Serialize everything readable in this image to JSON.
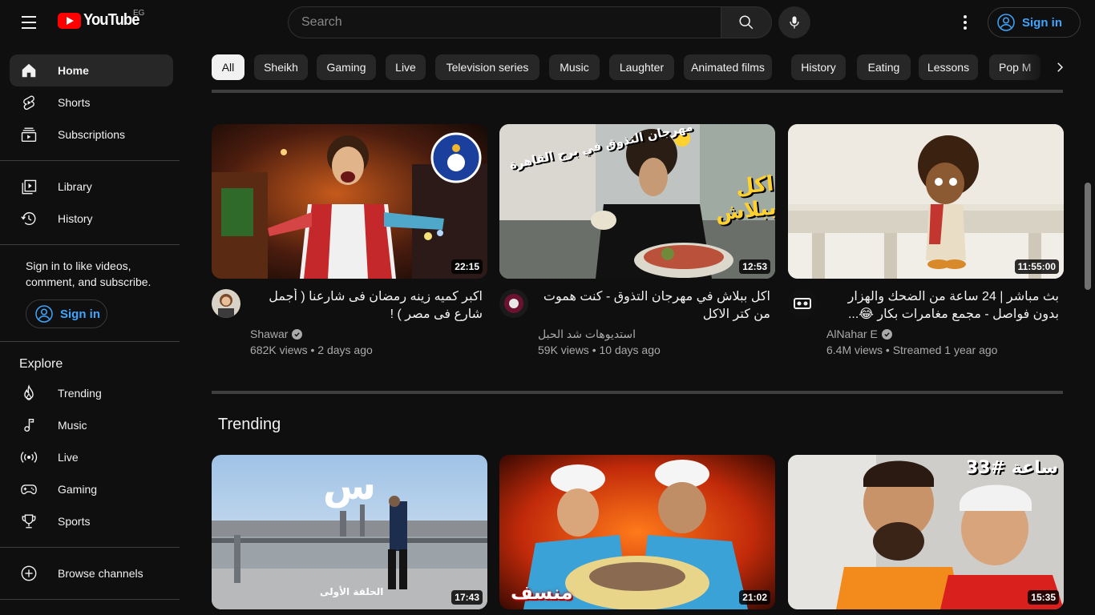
{
  "header": {
    "logo_text": "YouTube",
    "country_code": "EG",
    "search_placeholder": "Search",
    "signin_label": "Sign in"
  },
  "sidebar": {
    "items": [
      {
        "label": "Home",
        "icon": "home-icon",
        "active": true
      },
      {
        "label": "Shorts",
        "icon": "shorts-icon"
      },
      {
        "label": "Subscriptions",
        "icon": "subscriptions-icon"
      },
      {
        "label": "Library",
        "icon": "library-icon"
      },
      {
        "label": "History",
        "icon": "history-icon"
      }
    ],
    "signin_prompt": "Sign in to like videos, comment, and subscribe.",
    "signin_label": "Sign in",
    "explore_heading": "Explore",
    "explore_items": [
      {
        "label": "Trending",
        "icon": "trending-icon"
      },
      {
        "label": "Music",
        "icon": "music-icon"
      },
      {
        "label": "Live",
        "icon": "live-icon"
      },
      {
        "label": "Gaming",
        "icon": "gaming-icon"
      },
      {
        "label": "Sports",
        "icon": "sports-icon"
      }
    ],
    "browse_label": "Browse channels"
  },
  "chips": [
    "All",
    "Sheikh",
    "Gaming",
    "Live",
    "Television series",
    "Music",
    "Laughter",
    "Animated films",
    "History",
    "Eating",
    "Lessons",
    "Pop M"
  ],
  "videos": [
    {
      "title": "اكبر كميه زينه رمضان فى شارعنا ( أجمل شارع فى مصر ) !",
      "channel": "Shawar",
      "verified": true,
      "meta": "682K views • 2 days ago",
      "duration": "22:15",
      "thumb_badge": "GUINNESS WORLD RECORDS"
    },
    {
      "title": "اكل ببلاش في مهرجان التذوق - كنت هموت من كتر الاكل",
      "channel": "استديوهات شد الحبل",
      "verified": false,
      "meta": "59K views • 10 days ago",
      "duration": "12:53",
      "thumb_text_1": "مهرجان التذوق في برج القاهرة",
      "thumb_text_2": "اكل ببلاش"
    },
    {
      "title": "بث مباشر | 24 ساعة من الضحك والهزار بدون فواصل - مجمع مغامرات بكار 😂...",
      "channel": "AlNahar E",
      "verified": true,
      "meta": "6.4M views • Streamed 1 year ago",
      "duration": "11:55:00"
    }
  ],
  "trending": {
    "heading": "Trending",
    "videos": [
      {
        "duration": "17:43",
        "thumb_text": "الحلقة الأولى"
      },
      {
        "duration": "21:02",
        "thumb_text": "منسف"
      },
      {
        "duration": "15:35",
        "thumb_text": "ساعة #33"
      }
    ]
  },
  "colors": {
    "background": "#0f0f0f",
    "accent": "#3ea6ff",
    "brand_red": "#ff0000",
    "chip": "#272727"
  }
}
